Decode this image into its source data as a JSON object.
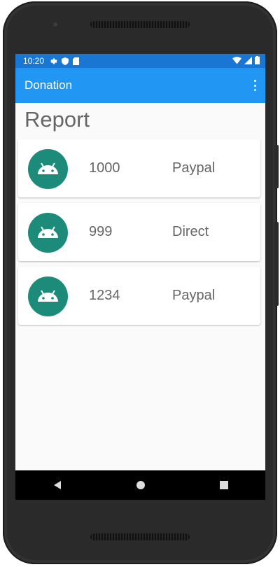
{
  "status_bar": {
    "time": "10:20",
    "left_icons": [
      "settings-icon",
      "shield-icon",
      "sim-card-icon"
    ],
    "right_icons": [
      "wifi-icon",
      "signal-icon",
      "battery-icon"
    ]
  },
  "app_bar": {
    "title": "Donation",
    "overflow_icon": "more-vert-icon"
  },
  "page_title": "Report",
  "donations": [
    {
      "amount": "1000",
      "method": "Paypal",
      "icon": "android-avatar-icon"
    },
    {
      "amount": "999",
      "method": "Direct",
      "icon": "android-avatar-icon"
    },
    {
      "amount": "1234",
      "method": "Paypal",
      "icon": "android-avatar-icon"
    }
  ],
  "nav_bar": [
    "back-icon",
    "home-icon",
    "recents-icon"
  ],
  "colors": {
    "status_bar": "#1976d2",
    "app_bar": "#2196f3",
    "avatar": "#1d8b7a",
    "nav_bar": "#000000"
  }
}
